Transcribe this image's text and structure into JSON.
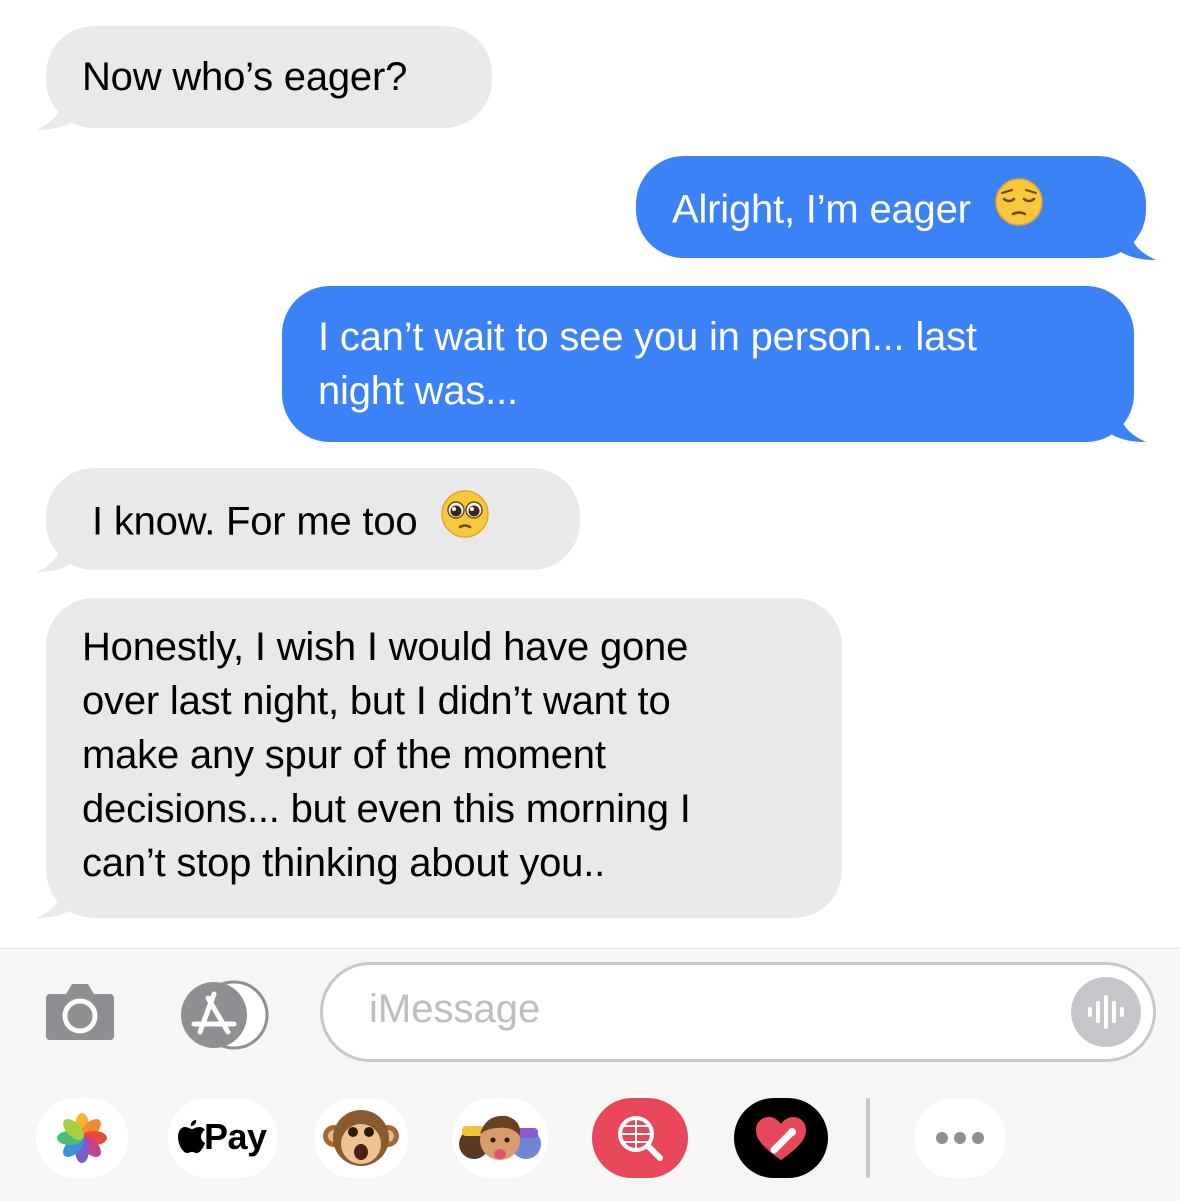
{
  "thread": {
    "messages": [
      {
        "direction": "incoming",
        "text": "Now who’s eager?"
      },
      {
        "direction": "outgoing",
        "text": "Alright, I’m eager",
        "emoji": "pensive-face"
      },
      {
        "direction": "outgoing",
        "text": "I can’t wait to see you in person... last\nnight was..."
      },
      {
        "direction": "incoming",
        "text": "I know. For me too",
        "emoji": "pleading-face"
      },
      {
        "direction": "incoming",
        "text": "Honestly, I wish I would have gone\nover last night, but I didn’t want to\nmake any spur of the moment\ndecisions... but even this morning I\ncan’t stop thinking about you.."
      }
    ]
  },
  "composer": {
    "placeholder": "iMessage",
    "camera_icon": "camera-icon",
    "apps_icon": "app-store-icon",
    "audio_icon": "waveform-icon"
  },
  "app_tray": {
    "items": [
      {
        "name": "photos",
        "icon": "photos-icon"
      },
      {
        "name": "apple-pay",
        "label": "Pay",
        "icon": "apple-logo-icon"
      },
      {
        "name": "animoji",
        "icon": "monkey-animoji-icon"
      },
      {
        "name": "memoji",
        "icon": "memoji-stickers-icon"
      },
      {
        "name": "images-search",
        "icon": "globe-search-icon"
      },
      {
        "name": "digital-touch",
        "icon": "heart-touch-icon"
      },
      {
        "name": "more",
        "icon": "more-dots-icon"
      }
    ]
  },
  "colors": {
    "incoming_bubble": "#e9e9eb",
    "outgoing_bubble": "#3b82f6",
    "tray_background": "#f6f6f6",
    "touch_red": "#e8475a"
  }
}
